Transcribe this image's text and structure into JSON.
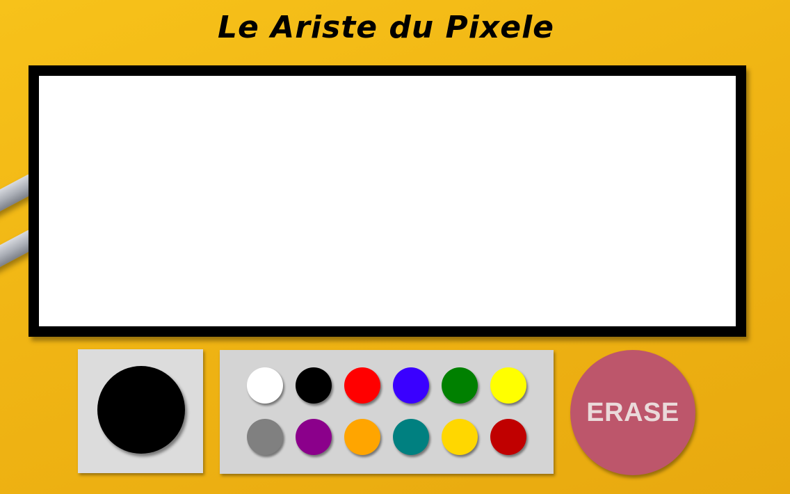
{
  "app": {
    "title": "Le Ariste du Pixele"
  },
  "current_color": {
    "value": "#000000"
  },
  "palette": [
    {
      "name": "white",
      "hex": "#ffffff"
    },
    {
      "name": "black",
      "hex": "#000000"
    },
    {
      "name": "red",
      "hex": "#ff0000"
    },
    {
      "name": "blue",
      "hex": "#3a00ff"
    },
    {
      "name": "green",
      "hex": "#008000"
    },
    {
      "name": "yellow",
      "hex": "#ffff00"
    },
    {
      "name": "gray",
      "hex": "#808080"
    },
    {
      "name": "purple",
      "hex": "#8b008b"
    },
    {
      "name": "orange",
      "hex": "#ffa500"
    },
    {
      "name": "teal",
      "hex": "#008080"
    },
    {
      "name": "gold",
      "hex": "#ffd700"
    },
    {
      "name": "dark-red",
      "hex": "#c00000"
    }
  ],
  "erase_button": {
    "label": "ERASE"
  },
  "colors": {
    "background": "#f0b514",
    "canvas": "#ffffff",
    "canvas_border": "#000000",
    "erase": "#bd566b"
  }
}
